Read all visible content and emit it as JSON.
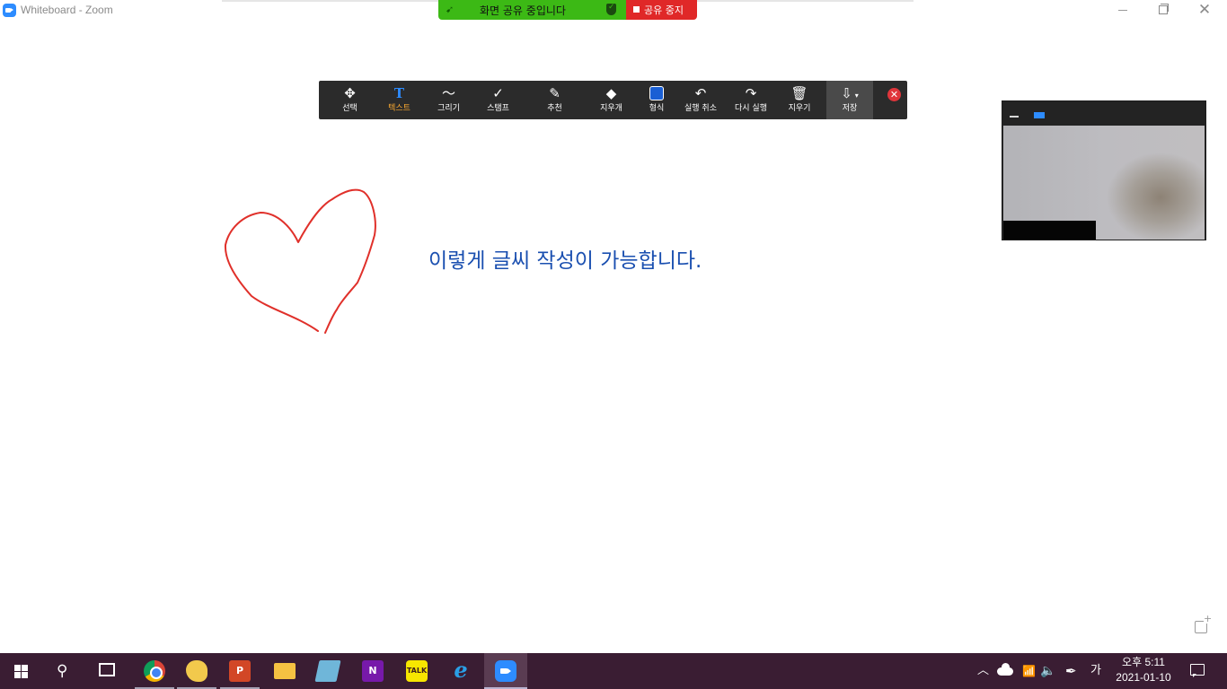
{
  "window": {
    "title": "Whiteboard - Zoom",
    "close_glyph": "✕"
  },
  "share_banner": {
    "status_text": "화면 공유 중입니다",
    "stop_label": "공유 중지",
    "status_color": "#3cb915",
    "stop_color": "#e02828"
  },
  "toolbar": {
    "tools": [
      {
        "label": "선택",
        "icon": "move-icon",
        "glyph": "✥"
      },
      {
        "label": "텍스트",
        "icon": "text-icon",
        "glyph": "T",
        "active": true
      },
      {
        "label": "그리기",
        "icon": "draw-icon",
        "glyph": "〜"
      },
      {
        "label": "스탬프",
        "icon": "stamp-icon",
        "glyph": "✓"
      },
      {
        "label": "추천",
        "icon": "spotlight-icon",
        "glyph": "✎"
      },
      {
        "label": "지우개",
        "icon": "eraser-icon",
        "glyph": "◆"
      },
      {
        "label": "형식",
        "icon": "format-icon",
        "glyph": ""
      },
      {
        "label": "실행 취소",
        "icon": "undo-icon",
        "glyph": "↶"
      },
      {
        "label": "다시 실행",
        "icon": "redo-icon",
        "glyph": "↷"
      },
      {
        "label": "지우기",
        "icon": "trash-icon",
        "glyph": "🗑"
      },
      {
        "label": "저장",
        "icon": "save-icon",
        "glyph": "⇩"
      }
    ],
    "close_glyph": "✕",
    "active_label_color": "#f7a731",
    "active_icon_color": "#2d8cff"
  },
  "whiteboard": {
    "text": "이렇게 글씨 작성이 가능합니다.",
    "text_color": "#1a4fb0",
    "stroke_color": "#e0302a"
  },
  "taskbar": {
    "apps": [
      "chrome-icon",
      "paint-3d-icon",
      "powerpoint-icon",
      "file-explorer-icon",
      "notepad-icon",
      "onenote-icon",
      "kakaotalk-icon",
      "internet-explorer-icon",
      "zoom-icon"
    ],
    "powerpoint_letter": "P",
    "onenote_letter": "N",
    "kakao_label": "TALK",
    "ie_letter": "e",
    "ime": "가",
    "time": "오후 5:11",
    "date": "2021-01-10"
  }
}
